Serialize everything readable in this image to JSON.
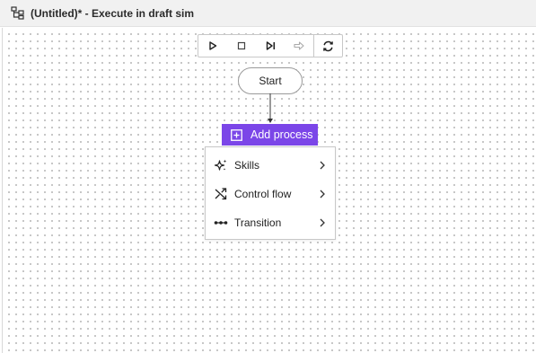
{
  "window": {
    "title": "(Untitled)* - Execute in draft sim",
    "icon": "workflow-icon"
  },
  "toolbar": {
    "buttons": [
      {
        "name": "play",
        "icon": "play-icon"
      },
      {
        "name": "stop",
        "icon": "stop-icon"
      },
      {
        "name": "step",
        "icon": "step-forward-icon"
      },
      {
        "name": "next",
        "icon": "arrow-right-icon",
        "disabled": true
      },
      {
        "name": "refresh",
        "icon": "refresh-icon"
      }
    ]
  },
  "flow": {
    "start_label": "Start",
    "add_process_label": "Add process"
  },
  "menu": {
    "items": [
      {
        "label": "Skills",
        "icon": "sparkle-icon"
      },
      {
        "label": "Control flow",
        "icon": "shuffle-icon"
      },
      {
        "label": "Transition",
        "icon": "transition-icon"
      }
    ]
  },
  "colors": {
    "accent": "#7b46e8",
    "title_bar": "#f1f1f1",
    "border": "#c8c8c8"
  }
}
